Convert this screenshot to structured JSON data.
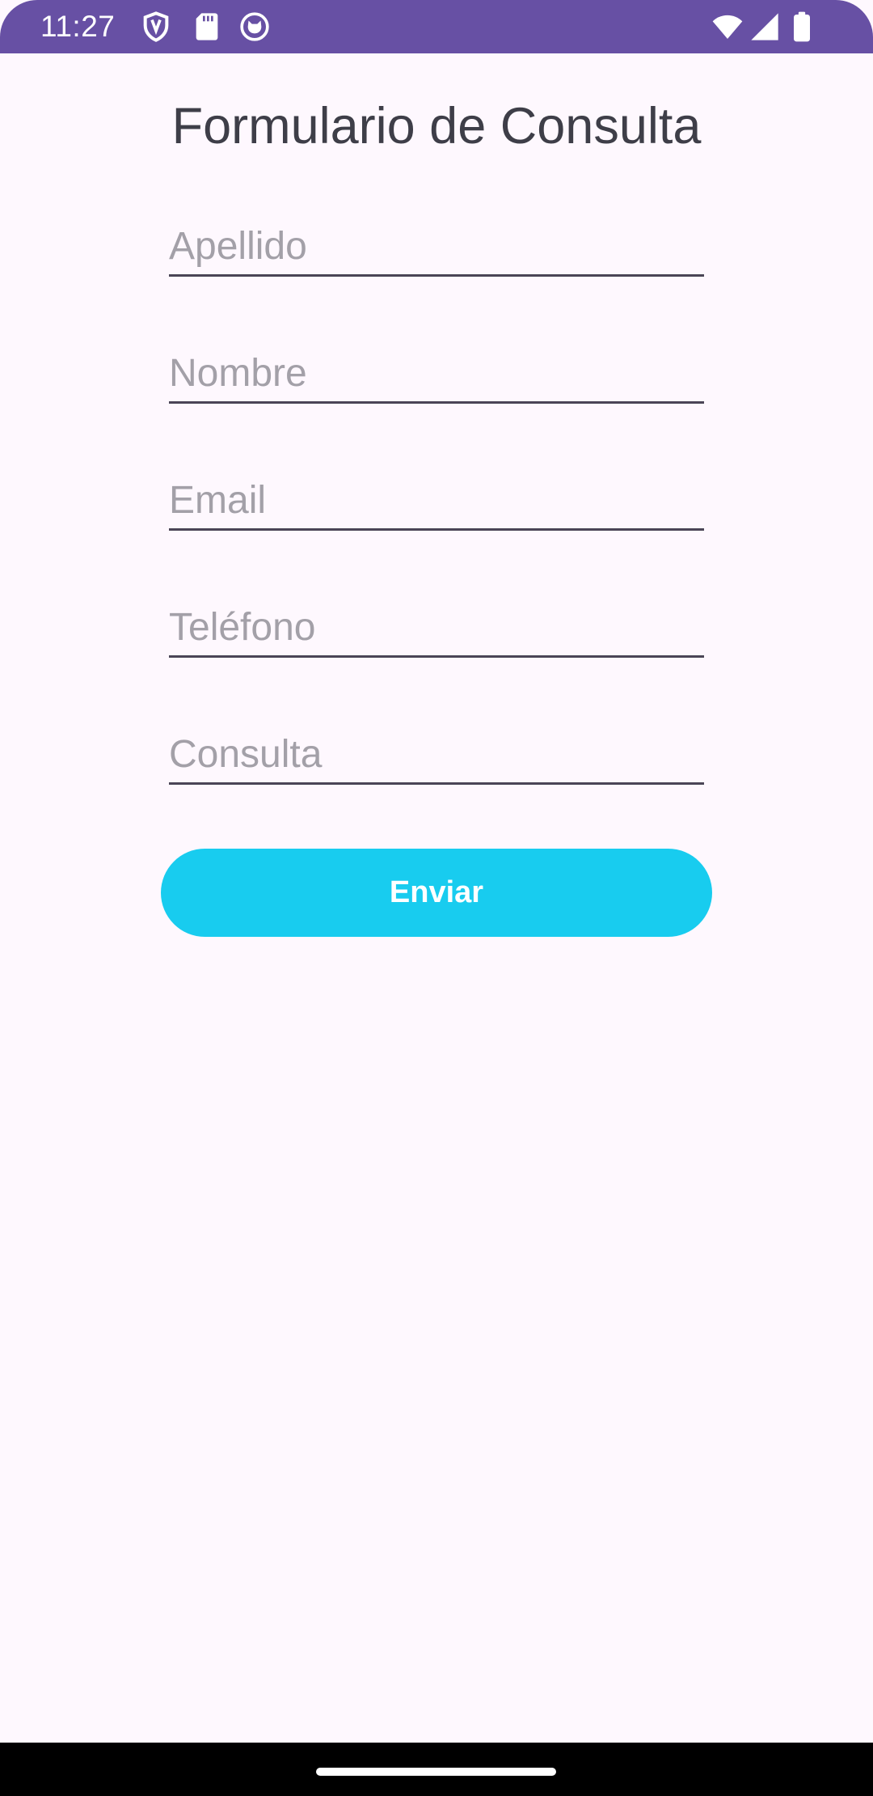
{
  "status_bar": {
    "time": "11:27",
    "icons": [
      "shield-icon",
      "sd-card-icon",
      "cat-face-icon",
      "wifi-icon",
      "signal-icon",
      "battery-icon"
    ],
    "color": "#6750A4"
  },
  "form": {
    "title": "Formulario de Consulta",
    "fields": [
      {
        "placeholder": "Apellido",
        "value": ""
      },
      {
        "placeholder": "Nombre",
        "value": ""
      },
      {
        "placeholder": "Email",
        "value": ""
      },
      {
        "placeholder": "Teléfono",
        "value": ""
      },
      {
        "placeholder": "Consulta",
        "value": ""
      }
    ],
    "submit_label": "Enviar",
    "submit_color": "#18CCEF"
  }
}
